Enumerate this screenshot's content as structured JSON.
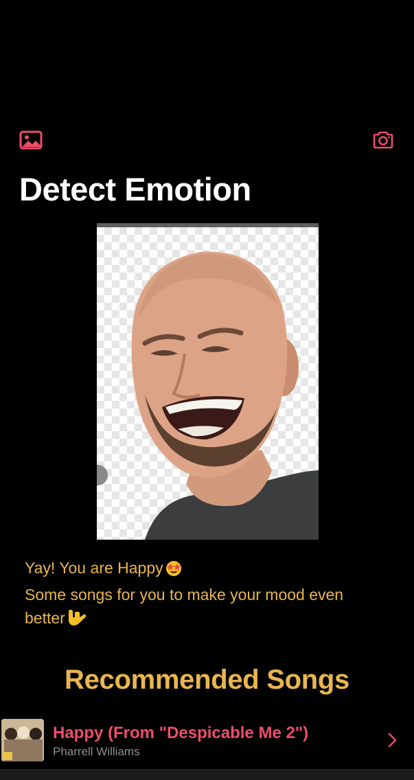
{
  "colors": {
    "accent": "#ee4d6a",
    "mood_text": "#e9b64e",
    "background": "#000000",
    "secondary_text": "#8f8f8f"
  },
  "toolbar": {
    "gallery_icon": "photo-gallery-icon",
    "camera_icon": "camera-icon"
  },
  "page": {
    "title": "Detect Emotion"
  },
  "result": {
    "line1": "Yay! You are Happy",
    "line2": "Some songs for you to make your mood even",
    "line3": "better",
    "emoji1": "star-struck-emoji",
    "emoji2": "love-you-gesture-emoji"
  },
  "recommended": {
    "title": "Recommended Songs",
    "songs": [
      {
        "title": "Happy (From \"Despicable Me 2\")",
        "artist": "Pharrell Williams"
      }
    ]
  }
}
